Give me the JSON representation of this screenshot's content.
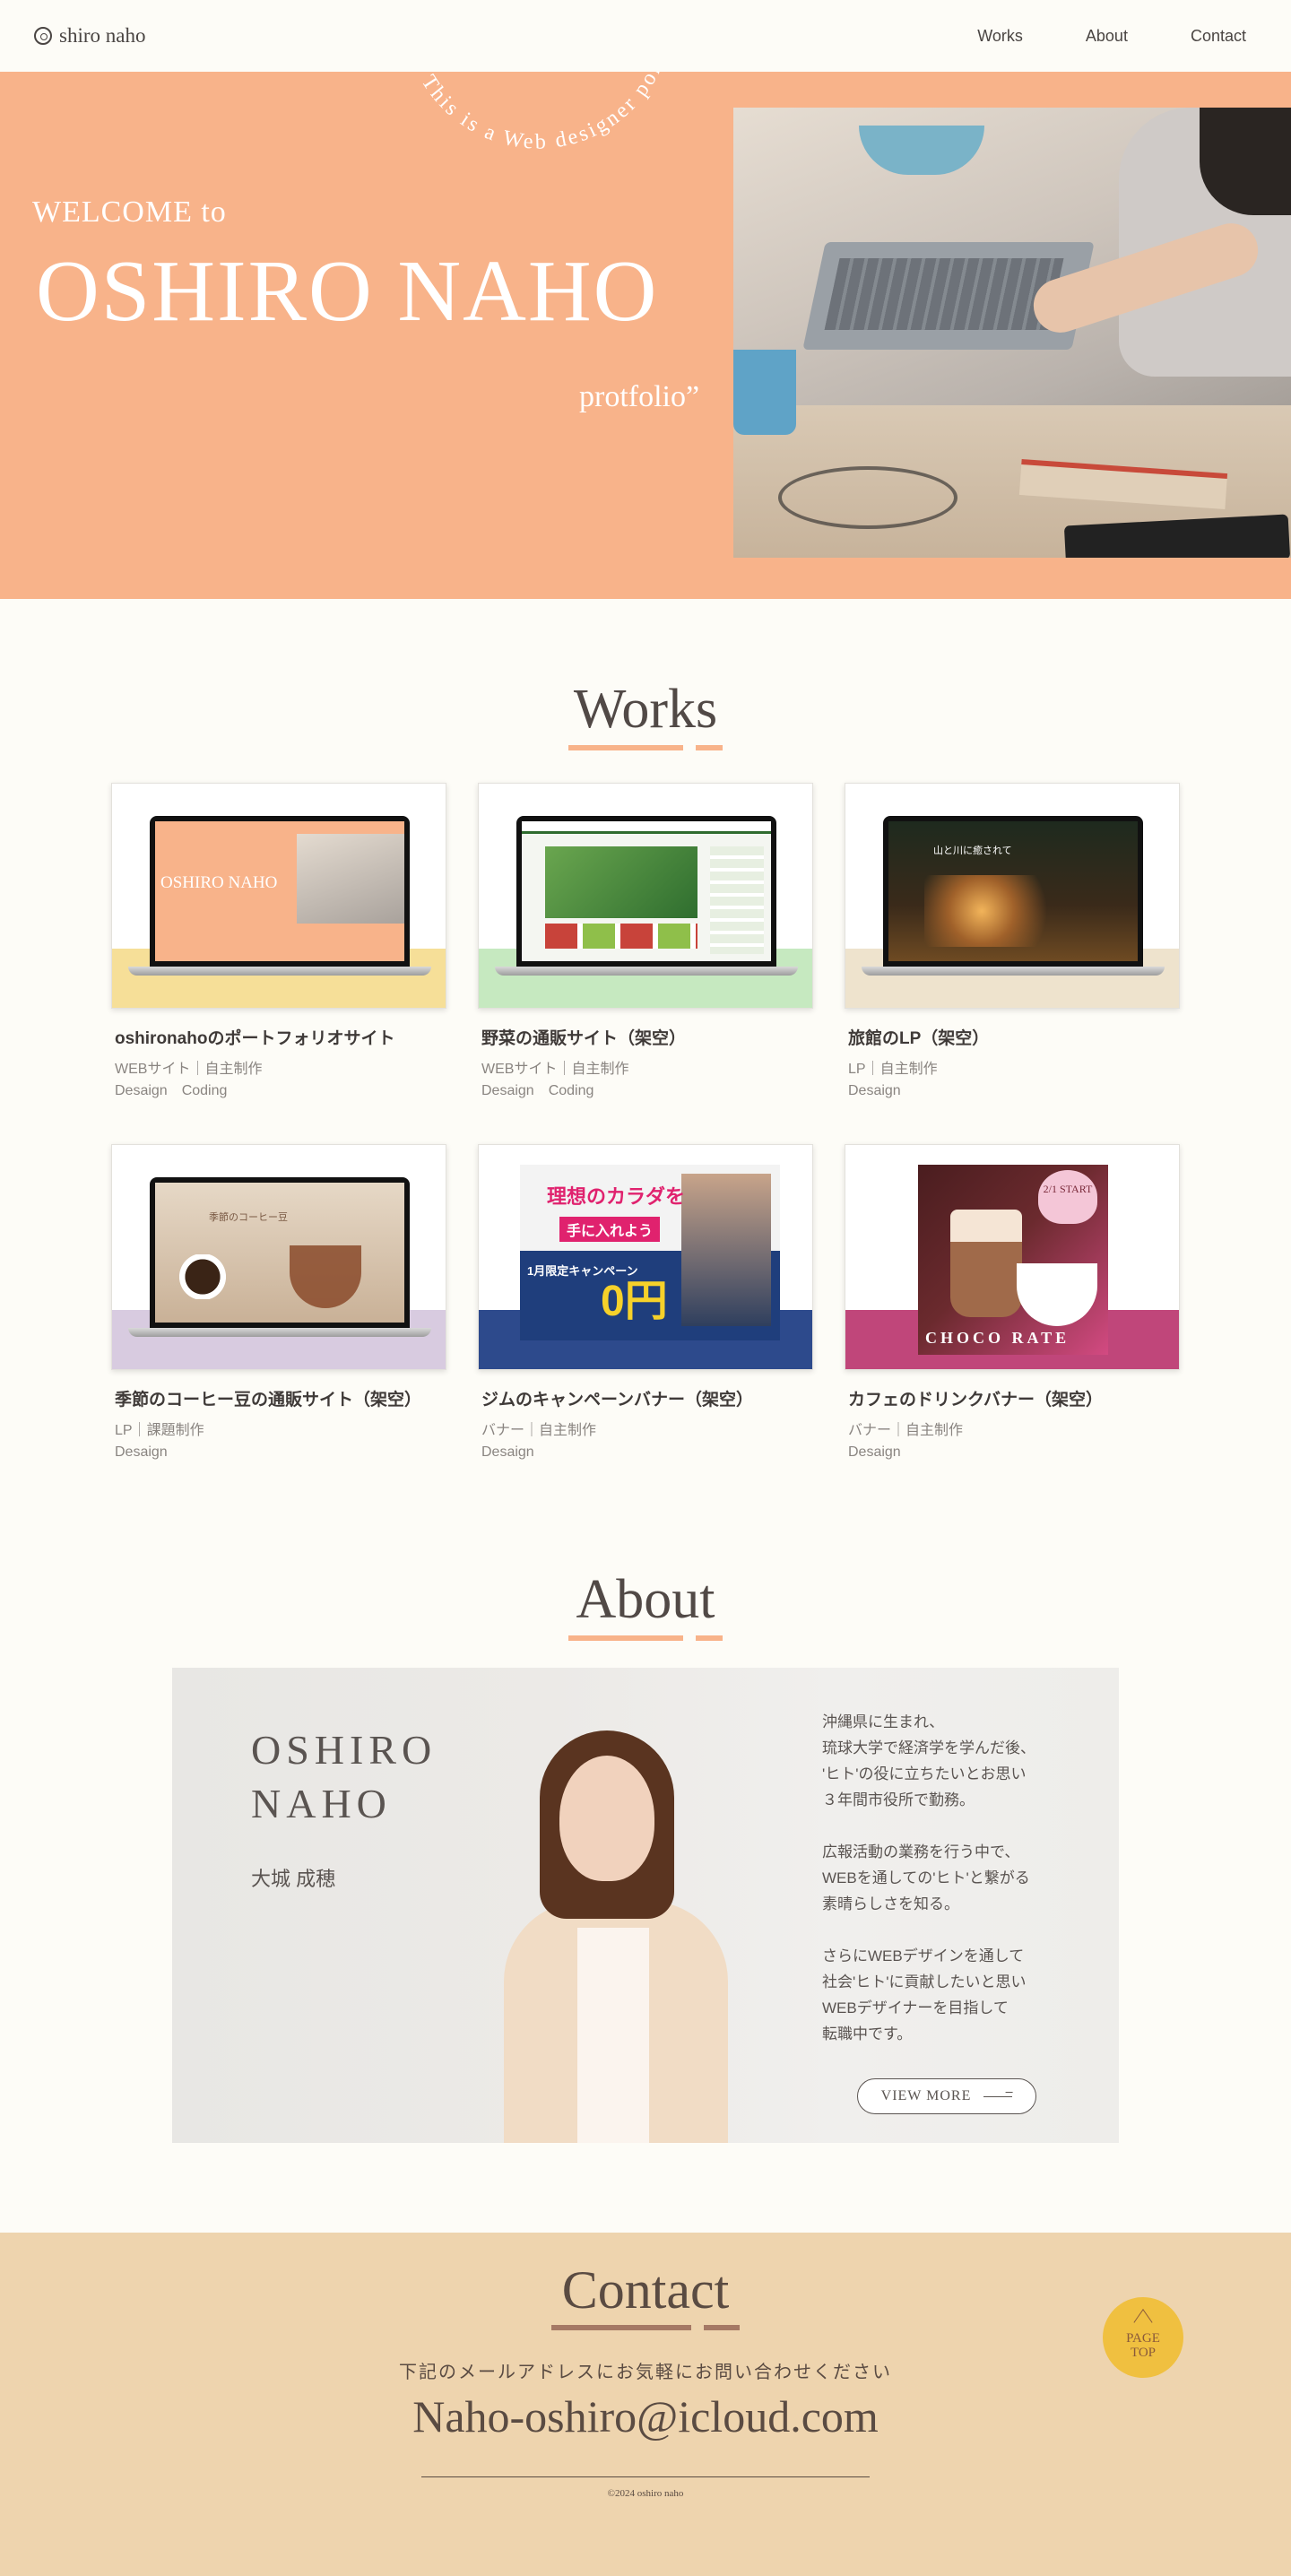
{
  "header": {
    "logo_text": "shiro naho",
    "nav": [
      {
        "label": "Works"
      },
      {
        "label": "About"
      },
      {
        "label": "Contact"
      }
    ]
  },
  "hero": {
    "arc_text": "This is a Web designer portf",
    "welcome": "WELCOME to",
    "name": "OSHIRO NAHO",
    "portfolio": "protfolio”"
  },
  "works": {
    "title": "Works",
    "items": [
      {
        "title": "oshironahoのポートフォリオサイト",
        "meta": "WEBサイト｜自主制作",
        "tags": [
          "Desaign",
          "Coding"
        ],
        "band_color": "#f6df98",
        "screen_text": "OSHIRO NAHO"
      },
      {
        "title": "野菜の通販サイト（架空）",
        "meta": "WEBサイト｜自主制作",
        "tags": [
          "Desaign",
          "Coding"
        ],
        "band_color": "#c6e9c0"
      },
      {
        "title": "旅館のLP（架空）",
        "meta": "LP｜自主制作",
        "tags": [
          "Desaign"
        ],
        "band_color": "#eee3cd",
        "screen_text": "山と川に癒されて"
      },
      {
        "title": "季節のコーヒー豆の通販サイト（架空）",
        "meta": "LP｜課題制作",
        "tags": [
          "Desaign"
        ],
        "band_color": "#d8cbe0",
        "screen_text": "季節のコーヒー豆"
      },
      {
        "title": "ジムのキャンペーンバナー（架空）",
        "meta": "バナー｜自主制作",
        "tags": [
          "Desaign"
        ],
        "band_color": "#2d4a8c",
        "banner_title": "理想のカラダを",
        "banner_sub": "手に入れよう",
        "banner_campaign": "1月限定キャンペーン",
        "banner_zero": "0円"
      },
      {
        "title": "カフェのドリンクバナー（架空）",
        "meta": "バナー｜自主制作",
        "tags": [
          "Desaign"
        ],
        "band_color": "#c0467a",
        "banner_date": "2/1 START",
        "banner_word": "CHOCO RATE"
      }
    ]
  },
  "about": {
    "title": "About",
    "name_en": "OSHIRO NAHO",
    "name_jp": "大城 成穂",
    "bio": "沖縄県に生まれ、\n琉球大学で経済学を学んだ後、\n'ヒト'の役に立ちたいとお思い\n３年間市役所で勤務。\n\n広報活動の業務を行う中で、\nWEBを通しての'ヒト'と繋がる\n素晴らしさを知る。\n\nさらにWEBデザインを通して\n社会'ヒト'に貢献したいと思い\nWEBデザイナーを目指して\n転職中です。",
    "button": "VIEW MORE"
  },
  "contact": {
    "title": "Contact",
    "lead": "下記のメールアドレスにお気軽にお問い合わせください",
    "email": "Naho-oshiro@icloud.com",
    "copyright": "©2024 oshiro naho",
    "page_top_line1": "PAGE",
    "page_top_line2": "TOP"
  },
  "colors": {
    "accent": "#f8b38a",
    "background": "#fdfcf7",
    "contact_bg": "#eed4ae",
    "page_top": "#f0c040"
  }
}
